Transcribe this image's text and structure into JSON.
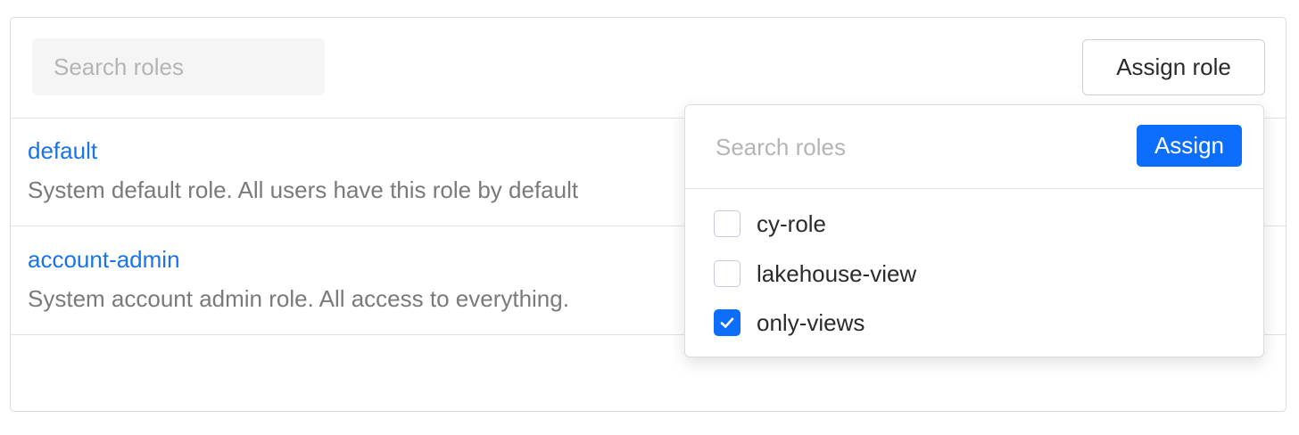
{
  "toolbar": {
    "search_placeholder": "Search roles",
    "assign_role_label": "Assign role"
  },
  "roles": [
    {
      "name": "default",
      "description": "System default role. All users have this role by default"
    },
    {
      "name": "account-admin",
      "description": "System account admin role. All access to everything."
    }
  ],
  "assign_dropdown": {
    "search_placeholder": "Search roles",
    "assign_label": "Assign",
    "options": [
      {
        "label": "cy-role",
        "checked": false
      },
      {
        "label": "lakehouse-view",
        "checked": false
      },
      {
        "label": "only-views",
        "checked": true
      }
    ]
  },
  "colors": {
    "link": "#1a73e8",
    "primary": "#0d6efd"
  },
  "icons": {
    "check": "checkmark-icon"
  }
}
